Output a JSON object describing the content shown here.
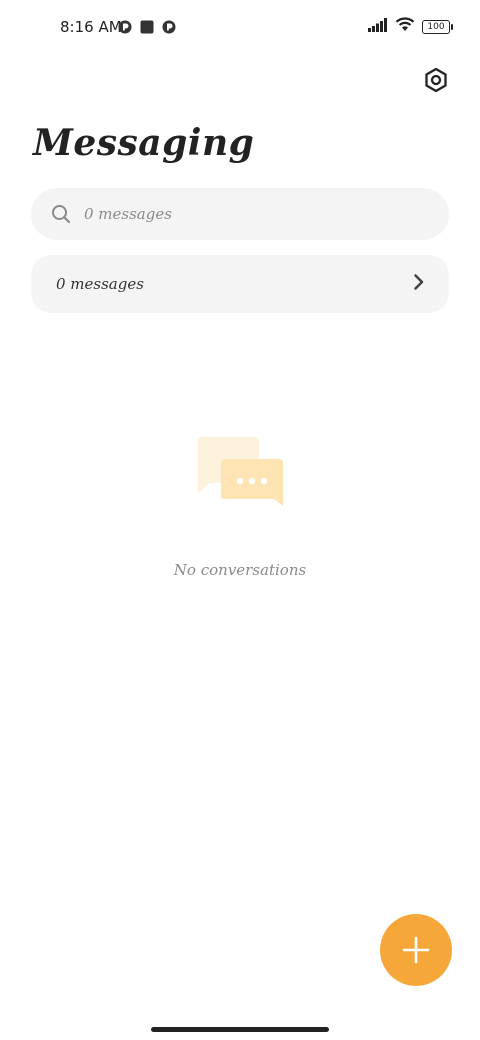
{
  "status_bar": {
    "time": "8:16 AM",
    "battery_level": "100",
    "icons": [
      "app-notification-icon",
      "square-notification-icon",
      "app-notification-icon",
      "signal-icon",
      "wifi-icon",
      "battery-icon"
    ]
  },
  "header": {
    "title": "Messaging",
    "settings_icon": "settings-hexagon-icon"
  },
  "search": {
    "placeholder": "0 messages",
    "icon": "search-icon"
  },
  "messages_row": {
    "label": "0 messages",
    "icon": "chevron-right-icon"
  },
  "empty_state": {
    "icon": "chat-bubbles-icon",
    "text": "No conversations"
  },
  "fab": {
    "icon": "plus-icon"
  },
  "colors": {
    "accent": "#f6a73a",
    "surface": "#f4f4f4",
    "text_primary": "#222222",
    "text_secondary": "#8a8a8a",
    "illustration_light": "#fdf0d6",
    "illustration_mid": "#fde3ad"
  }
}
